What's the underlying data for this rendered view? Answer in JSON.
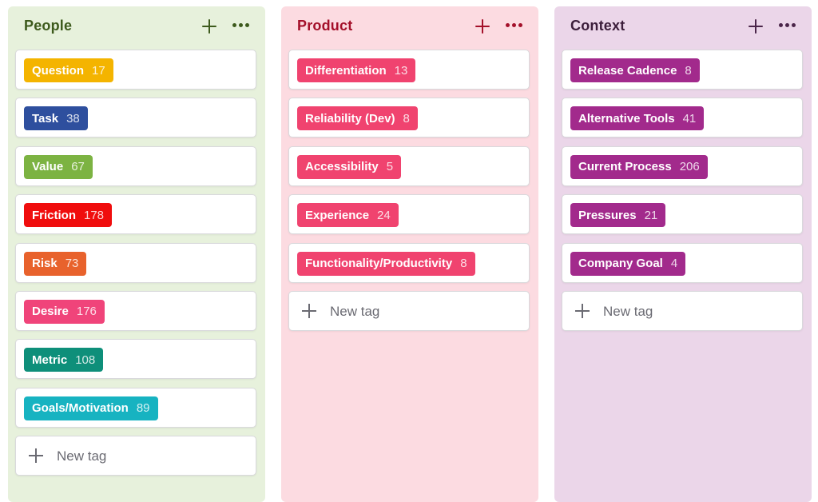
{
  "new_tag_label": "New tag",
  "columns": [
    {
      "title": "People",
      "title_color": "#3d5a1c",
      "icon_color": "#3d5a1c",
      "tags": [
        {
          "label": "Question",
          "count": "17",
          "color": "#f4b400"
        },
        {
          "label": "Task",
          "count": "38",
          "color": "#2e4f9e"
        },
        {
          "label": "Value",
          "count": "67",
          "color": "#7cb342"
        },
        {
          "label": "Friction",
          "count": "178",
          "color": "#f00d0d"
        },
        {
          "label": "Risk",
          "count": "73",
          "color": "#e8622c"
        },
        {
          "label": "Desire",
          "count": "176",
          "color": "#f0447a"
        },
        {
          "label": "Metric",
          "count": "108",
          "color": "#0e8f7a"
        },
        {
          "label": "Goals/Motivation",
          "count": "89",
          "color": "#17b3c1"
        }
      ]
    },
    {
      "title": "Product",
      "title_color": "#a4102a",
      "icon_color": "#a4102a",
      "tags": [
        {
          "label": "Differentiation",
          "count": "13",
          "color": "#f0436f"
        },
        {
          "label": "Reliability (Dev)",
          "count": "8",
          "color": "#f0436f"
        },
        {
          "label": "Accessibility",
          "count": "5",
          "color": "#f0436f"
        },
        {
          "label": "Experience",
          "count": "24",
          "color": "#f0436f"
        },
        {
          "label": "Functionality/Productivity",
          "count": "8",
          "color": "#f0436f"
        }
      ]
    },
    {
      "title": "Context",
      "title_color": "#3b1d3a",
      "icon_color": "#4a2549",
      "tags": [
        {
          "label": "Release Cadence",
          "count": "8",
          "color": "#a22a8c"
        },
        {
          "label": "Alternative Tools",
          "count": "41",
          "color": "#a22a8c"
        },
        {
          "label": "Current Process",
          "count": "206",
          "color": "#a22a8c"
        },
        {
          "label": "Pressures",
          "count": "21",
          "color": "#a22a8c"
        },
        {
          "label": "Company Goal",
          "count": "4",
          "color": "#a22a8c"
        }
      ]
    }
  ]
}
